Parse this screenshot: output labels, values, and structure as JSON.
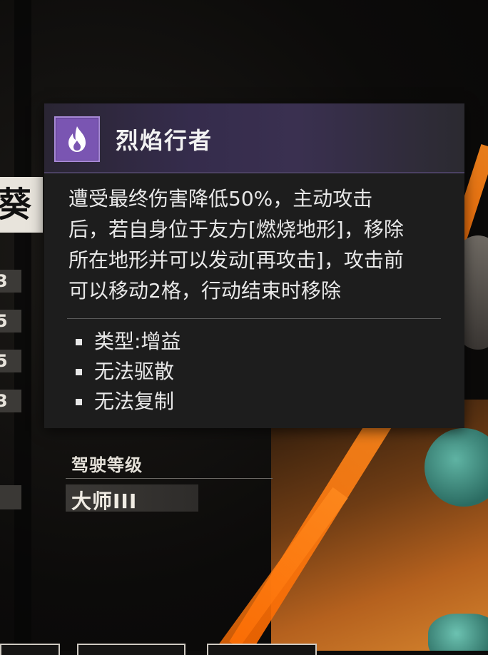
{
  "left_panel": {
    "name_char": "葵",
    "stats": [
      "3",
      "5",
      "5",
      "3"
    ]
  },
  "tooltip": {
    "icon": "flame-icon",
    "title": "烈焰行者",
    "description_lines": [
      "遭受最终伤害降低50%，主动攻击",
      "后，若自身位于友方[燃烧地形]，移除",
      "所在地形并可以发动[再攻击]，攻击前",
      "可以移动2格，行动结束时移除"
    ],
    "tags": [
      "类型:增益",
      "无法驱散",
      "无法复制"
    ]
  },
  "pilot": {
    "label": "驾驶等级",
    "value": "大师III"
  },
  "colors": {
    "tooltip_bg": "#1d1d1d",
    "header_accent": "#3a3050",
    "icon_purple": "#7a55b2",
    "text": "#e8e8e8",
    "bg_orange": "#ff7a12"
  }
}
